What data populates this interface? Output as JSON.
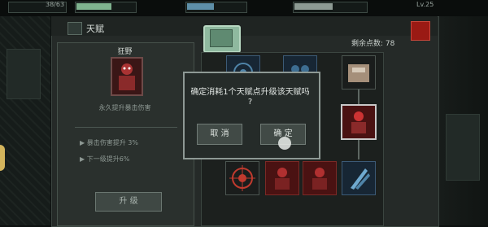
{
  "hud": {
    "level_text": "Lv.25",
    "left_bar_text": "38/63",
    "hp_fill": 0.62,
    "mp_fill": 0.47,
    "xp_fill": 0.55
  },
  "panel": {
    "title": "天赋",
    "remaining_points": "剩余点数: 78"
  },
  "card": {
    "talent_name": "狂野",
    "description": "永久提升暴击伤害",
    "stat_1": "▶ 暴击伤害提升 3%",
    "stat_2": "▶ 下一级提升6%",
    "upgrade_label": "升 级"
  },
  "dialog": {
    "message_line1": "确定消耗1个天赋点升级该天赋吗",
    "message_line2": "?",
    "cancel_label": "取 消",
    "confirm_label": "确 定"
  },
  "icons": {
    "title": "talent-icon",
    "portrait": "wild-warrior-icon",
    "nodes": [
      "gear-talent-icon",
      "team-talent-icon",
      "ammo-crate-icon",
      "wild-warrior-icon",
      "crosshair-icon",
      "warrior-red-icon",
      "warrior-red-icon",
      "bullet-blade-icon"
    ]
  },
  "colors": {
    "accent_green": "#8fb99f",
    "hp": "#7fb38f",
    "mp": "#5e8fa8",
    "danger": "#9a1a14"
  }
}
